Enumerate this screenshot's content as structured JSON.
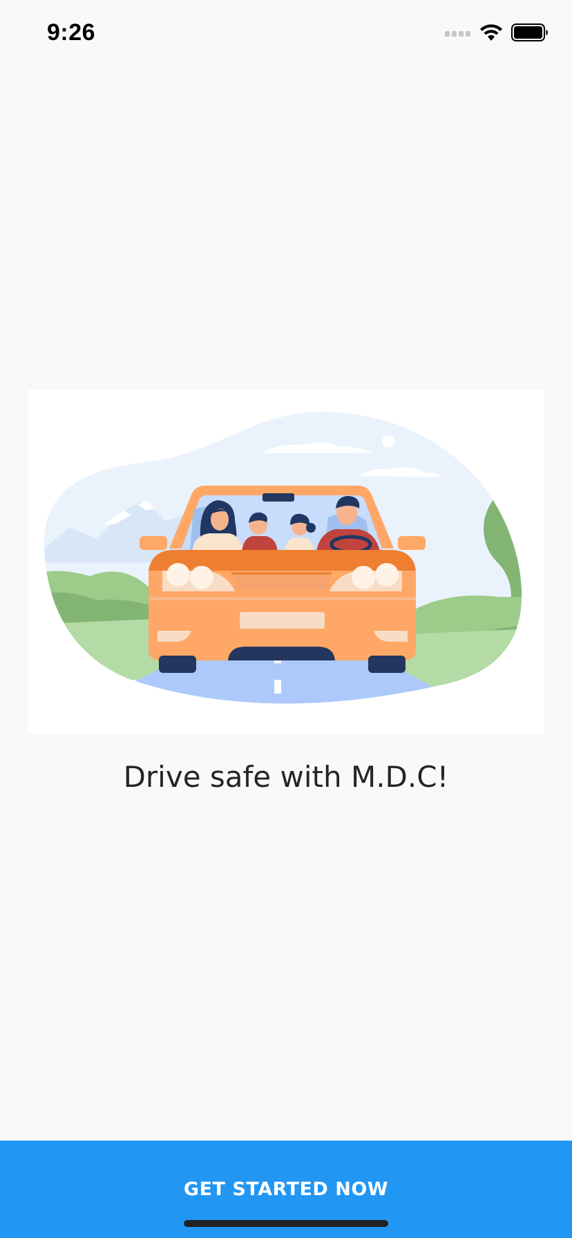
{
  "status_bar": {
    "time": "9:26",
    "icons": [
      "cellular-signal-icon",
      "wifi-icon",
      "battery-icon"
    ]
  },
  "illustration": {
    "subject": "family-in-car-illustration"
  },
  "main": {
    "tagline": "Drive safe with M.D.C!"
  },
  "cta": {
    "label": "GET STARTED NOW"
  },
  "colors": {
    "accent": "#2196f3",
    "background": "#f9f9f9",
    "car": "#ffa766",
    "road": "#adc8fb"
  }
}
